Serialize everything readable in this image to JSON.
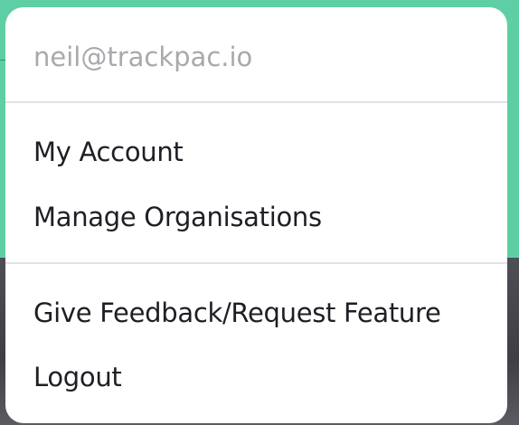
{
  "menu": {
    "email": "neil@trackpac.io",
    "items_group_1": [
      {
        "label": "My Account"
      },
      {
        "label": "Manage Organisations"
      }
    ],
    "items_group_2": [
      {
        "label": "Give Feedback/Request Feature"
      },
      {
        "label": "Logout"
      }
    ]
  },
  "colors": {
    "background_top": "#5ecfa4",
    "background_bottom": "#45464c",
    "menu_background": "#ffffff",
    "email_text": "#a9a9ad",
    "item_text": "#1e1f24",
    "divider": "#e2e2e4"
  }
}
